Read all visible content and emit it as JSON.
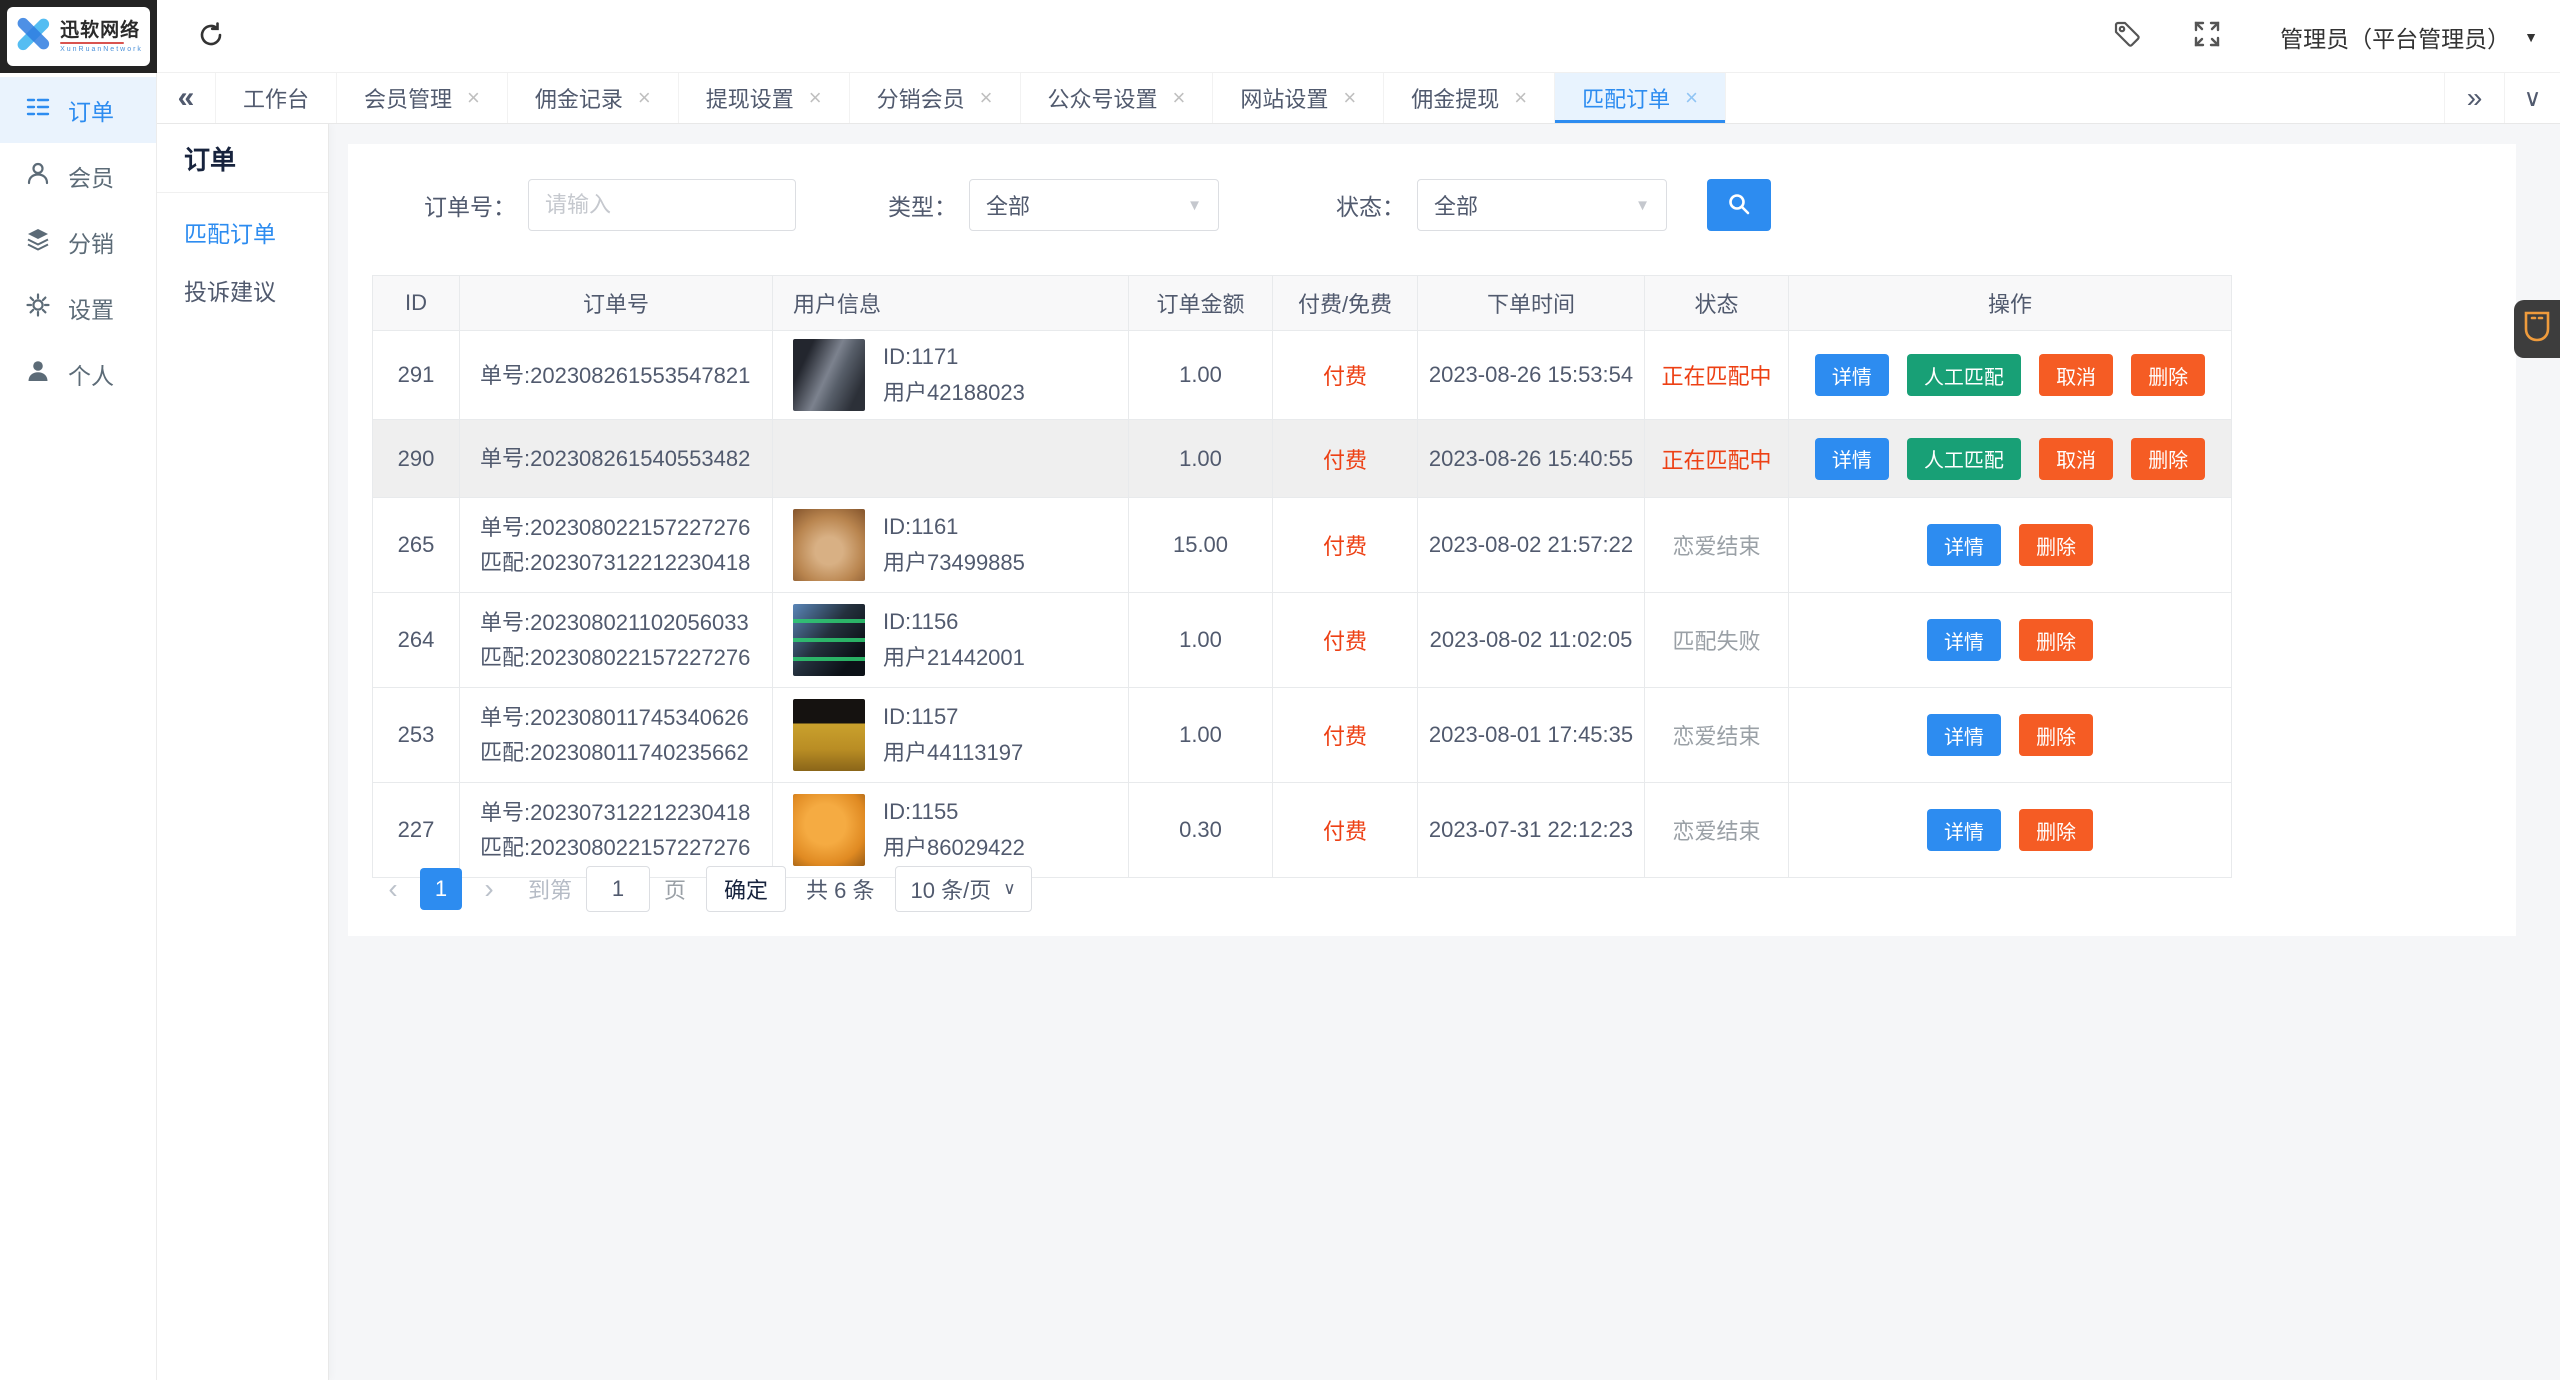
{
  "topbar": {
    "logo_title": "迅软网络",
    "logo_subtitle": "XunRuanNetwork",
    "user_label": "管理员（平台管理员）"
  },
  "icons": {
    "collapse": "«",
    "expand": "»",
    "chevron_down": "∨",
    "caret_down": "▼",
    "select_caret": "▼",
    "prev": "‹",
    "next": "›",
    "close": "×",
    "list_icon": "order-list",
    "search_icon": "magnifier",
    "refresh_icon": "refresh",
    "tag_icon": "tag",
    "fullscreen_icon": "fullscreen",
    "device_icon": "device"
  },
  "sidebar": {
    "items": [
      {
        "label": "订单"
      },
      {
        "label": "会员"
      },
      {
        "label": "分销"
      },
      {
        "label": "设置"
      },
      {
        "label": "个人"
      }
    ]
  },
  "tabs": [
    {
      "label": "工作台"
    },
    {
      "label": "会员管理"
    },
    {
      "label": "佣金记录"
    },
    {
      "label": "提现设置"
    },
    {
      "label": "分销会员"
    },
    {
      "label": "公众号设置"
    },
    {
      "label": "网站设置"
    },
    {
      "label": "佣金提现"
    },
    {
      "label": "匹配订单"
    }
  ],
  "submenu": {
    "title": "订单",
    "items": [
      {
        "label": "匹配订单"
      },
      {
        "label": "投诉建议"
      }
    ]
  },
  "filters": {
    "order_label": "订单号：",
    "order_placeholder": "请输入",
    "type_label": "类型：",
    "type_value": "全部",
    "status_label": "状态：",
    "status_value": "全部"
  },
  "table": {
    "columns": [
      "ID",
      "订单号",
      "用户信息",
      "订单金额",
      "付费/免费",
      "下单时间",
      "状态",
      "操作"
    ],
    "rows": [
      {
        "id": "291",
        "line1": "单号:202308261553547821",
        "user_id": "ID:1171",
        "user_name": "用户42188023",
        "avatar": "dark-haired-portrait-avatar",
        "amount": "1.00",
        "pay": "付费",
        "time": "2023-08-26 15:53:54",
        "status": "正在匹配中",
        "btn_detail": "详情",
        "btn_manual": "人工匹配",
        "btn_cancel": "取消",
        "btn_delete": "删除"
      },
      {
        "id": "290",
        "line1": "单号:202308261540553482",
        "amount": "1.00",
        "pay": "付费",
        "time": "2023-08-26 15:40:55",
        "status": "正在匹配中",
        "btn_detail": "详情",
        "btn_manual": "人工匹配",
        "btn_cancel": "取消",
        "btn_delete": "删除"
      },
      {
        "id": "265",
        "line1": "单号:202308022157227276",
        "line2": "匹配:202307312212230418",
        "user_id": "ID:1161",
        "user_name": "用户73499885",
        "avatar": "dog-photo-avatar",
        "amount": "15.00",
        "pay": "付费",
        "time": "2023-08-02 21:57:22",
        "status": "恋爱结束",
        "btn_detail": "详情",
        "btn_delete": "删除"
      },
      {
        "id": "264",
        "line1": "单号:202308021102056033",
        "line2": "匹配:202308022157227276",
        "user_id": "ID:1156",
        "user_name": "用户21442001",
        "avatar": "game-screenshot-avatar",
        "amount": "1.00",
        "pay": "付费",
        "time": "2023-08-02 11:02:05",
        "status": "匹配失败",
        "btn_detail": "详情",
        "btn_delete": "删除"
      },
      {
        "id": "253",
        "line1": "单号:202308011745340626",
        "line2": "匹配:202308011740235662",
        "user_id": "ID:1157",
        "user_name": "用户44113197",
        "avatar": "poster-monkey-avatar",
        "amount": "1.00",
        "pay": "付费",
        "time": "2023-08-01 17:45:35",
        "status": "恋爱结束",
        "btn_detail": "详情",
        "btn_delete": "删除"
      },
      {
        "id": "227",
        "line1": "单号:202307312212230418",
        "line2": "匹配:202308022157227276",
        "user_id": "ID:1155",
        "user_name": "用户86029422",
        "avatar": "orange-cartoon-cat-avatar",
        "amount": "0.30",
        "pay": "付费",
        "time": "2023-07-31 22:12:23",
        "status": "恋爱结束",
        "btn_detail": "详情",
        "btn_delete": "删除"
      }
    ]
  },
  "pagination": {
    "current": "1",
    "goto_label": "到第",
    "goto_value": "1",
    "page_suffix": "页",
    "confirm": "确定",
    "total": "共 6 条",
    "page_size": "10 条/页"
  },
  "colors": {
    "primary": "#2d8cf0",
    "success": "#18a076",
    "warning_orange": "#f55c24",
    "error_text": "#ed4014",
    "tab_active_bg": "#e8f3fe",
    "sidebar_active_bg": "#eaf3fd",
    "table_header_bg": "#f8f8f9"
  }
}
